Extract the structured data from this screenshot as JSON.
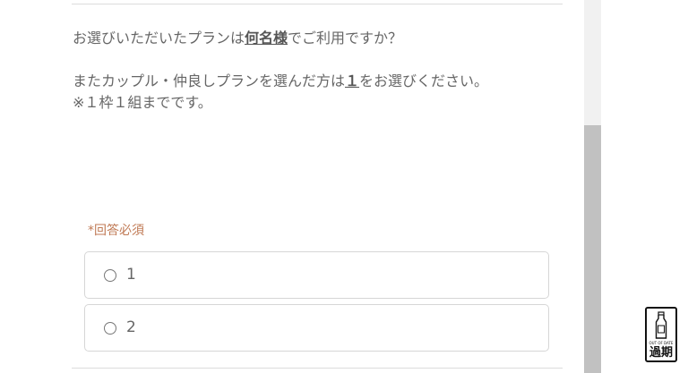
{
  "question": {
    "line1_before": "お選びいただいたプランは",
    "line1_bold": "何名様",
    "line1_after": "でご利用ですか？",
    "line2_before": "またカップル・仲良しプランを選んだ方は",
    "line2_bold": "１",
    "line2_after": "をお選びください。",
    "line3": "※１枠１組までです。"
  },
  "required_label": "*回答必須",
  "options": [
    {
      "label": "1",
      "selected": false
    },
    {
      "label": "2",
      "selected": false
    }
  ],
  "badge": {
    "small_text": "OUT OF DATE",
    "main_text": "過期",
    "icon": "milk-bottle-icon"
  },
  "colors": {
    "text": "#666666",
    "required": "#c07a55",
    "border": "#d6d6d6",
    "scroll_thumb": "#c1c1c1"
  }
}
